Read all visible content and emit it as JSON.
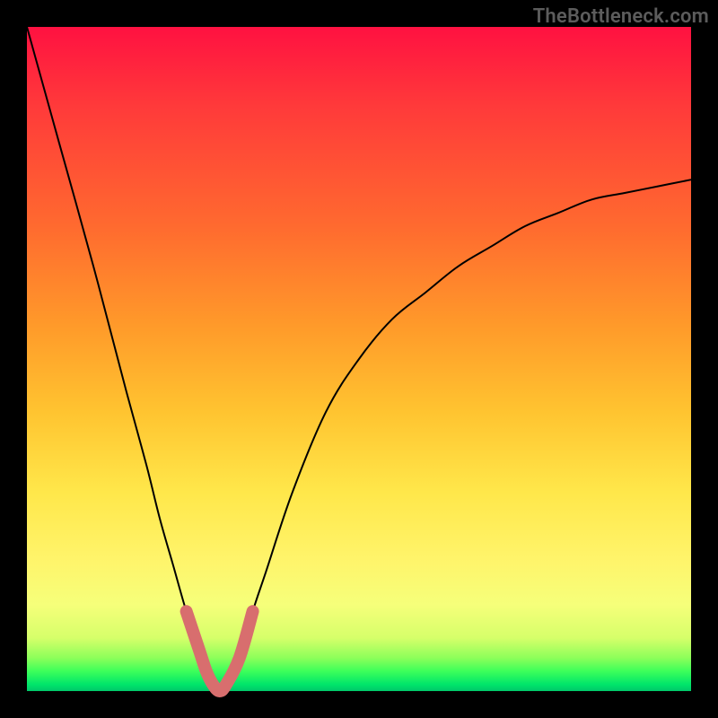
{
  "watermark": "TheBottleneck.com",
  "colors": {
    "background": "#000000",
    "curve": "#000000",
    "marker": "#d86e6e"
  },
  "chart_data": {
    "type": "line",
    "title": "",
    "xlabel": "",
    "ylabel": "",
    "xlim": [
      0,
      100
    ],
    "ylim": [
      0,
      100
    ],
    "x": [
      0,
      5,
      10,
      15,
      18,
      20,
      22,
      24,
      26,
      27,
      28,
      29,
      30,
      32,
      34,
      36,
      40,
      45,
      50,
      55,
      60,
      65,
      70,
      75,
      80,
      85,
      90,
      95,
      100
    ],
    "values": [
      100,
      82,
      64,
      45,
      34,
      26,
      19,
      12,
      6,
      3,
      1,
      0,
      1,
      5,
      12,
      18,
      30,
      42,
      50,
      56,
      60,
      64,
      67,
      70,
      72,
      74,
      75,
      76,
      77
    ],
    "marker_region_x": [
      24,
      26,
      27,
      28,
      29,
      30,
      32,
      34
    ],
    "marker_region_y": [
      12,
      6,
      3,
      1,
      0,
      1,
      5,
      12
    ],
    "note": "Values are percentages read from position in plot; curve is a V/checkmark shape with minimum near x≈28."
  }
}
